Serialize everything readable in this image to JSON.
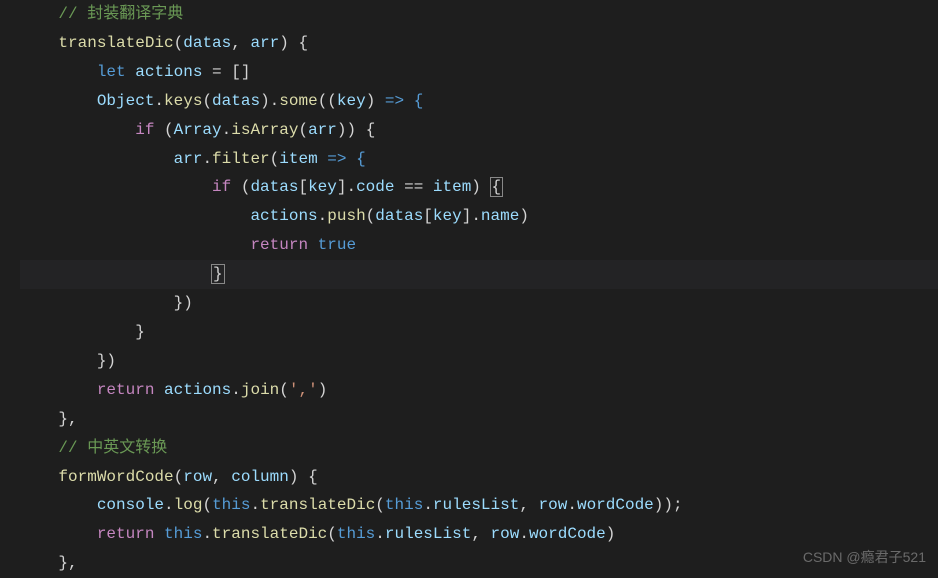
{
  "code": {
    "l1": {
      "indent": "    ",
      "comment": "// 封装翻译字典"
    },
    "l2": {
      "indent": "    ",
      "fn": "translateDic",
      "p1": "datas",
      "p2": "arr",
      "brace": " {"
    },
    "l3": {
      "indent": "        ",
      "kw": "let",
      "v": "actions",
      "eq": " = []"
    },
    "l4": {
      "indent": "        ",
      "obj": "Object",
      "dot1": ".",
      "keys": "keys",
      "p1": "datas",
      "dot2": ".",
      "some": "some",
      "arg": "key",
      "arrow": " => {"
    },
    "l5": {
      "indent": "            ",
      "if": "if",
      "open": " (",
      "arr": "Array",
      "dot": ".",
      "isArr": "isArray",
      "p": "arr",
      "close": ") {"
    },
    "l6": {
      "indent": "                ",
      "arr": "arr",
      "dot": ".",
      "filter": "filter",
      "item": "item",
      "arrow": " => {"
    },
    "l7": {
      "indent": "                    ",
      "if": "if",
      "open": " (",
      "datas": "datas",
      "b1": "[",
      "key": "key",
      "b2": "].",
      "code": "code",
      "eq": " == ",
      "item": "item",
      "close": ") ",
      "brace": "{"
    },
    "l8": {
      "indent": "                        ",
      "actions": "actions",
      "dot": ".",
      "push": "push",
      "open": "(",
      "datas": "datas",
      "b1": "[",
      "key": "key",
      "b2": "].",
      "name": "name",
      "close": ")"
    },
    "l9": {
      "indent": "                        ",
      "return": "return",
      "sp": " ",
      "true": "true"
    },
    "l10": {
      "indent": "                    ",
      "brace": "}"
    },
    "l11": {
      "indent": "                })"
    },
    "l12": {
      "indent": "            }"
    },
    "l13": {
      "indent": "        })"
    },
    "l14": {
      "indent": "        ",
      "return": "return",
      "sp": " ",
      "actions": "actions",
      "dot": ".",
      "join": "join",
      "open": "(",
      "str": "','",
      "close": ")"
    },
    "l15": {
      "indent": "    },"
    },
    "l16": {
      "indent": "    ",
      "comment": "// 中英文转换"
    },
    "l17": {
      "indent": "    ",
      "fn": "formWordCode",
      "p1": "row",
      "p2": "column",
      "brace": " {"
    },
    "l18": {
      "indent": "        ",
      "console": "console",
      "dot": ".",
      "log": "log",
      "open": "(",
      "this1": "this",
      "dot2": ".",
      "td": "translateDic",
      "open2": "(",
      "this2": "this",
      "dot3": ".",
      "rules": "rulesList",
      "comma": ", ",
      "row": "row",
      "dot4": ".",
      "wc": "wordCode",
      "close": "));"
    },
    "l19": {
      "indent": "        ",
      "return": "return",
      "sp": " ",
      "this1": "this",
      "dot": ".",
      "td": "translateDic",
      "open": "(",
      "this2": "this",
      "dot2": ".",
      "rules": "rulesList",
      "comma": ", ",
      "row": "row",
      "dot3": ".",
      "wc": "wordCode",
      "close": ")"
    },
    "l20": {
      "indent": "    },"
    }
  },
  "watermark": "CSDN @瘾君子521"
}
